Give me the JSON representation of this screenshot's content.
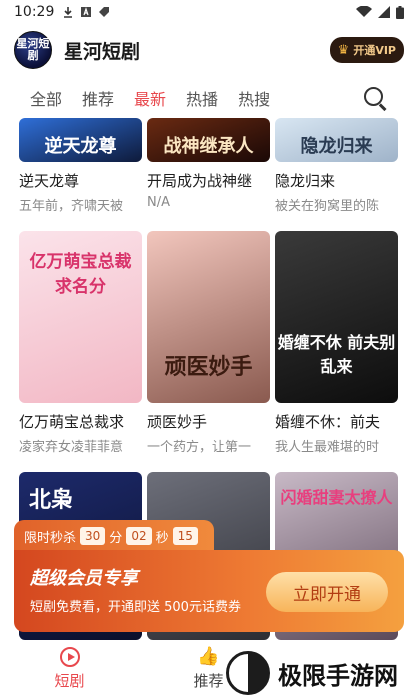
{
  "status_bar": {
    "time": "10:29"
  },
  "header": {
    "logo_text": "星河短剧",
    "title": "星河短剧",
    "vip_label": "开通VIP"
  },
  "tabs": [
    {
      "label": "全部"
    },
    {
      "label": "推荐"
    },
    {
      "label": "最新",
      "active": true
    },
    {
      "label": "热播"
    },
    {
      "label": "热搜"
    }
  ],
  "dramas": [
    {
      "poster_text": "逆天龙尊",
      "title": "逆天龙尊",
      "subtitle": "五年前，齐啸天被",
      "colors": [
        "#2f6fd8",
        "#0e1a3a"
      ]
    },
    {
      "poster_text": "战神继承人",
      "title": "开局成为战神继",
      "subtitle": "N/A",
      "colors": [
        "#6a2a12",
        "#1a0806"
      ]
    },
    {
      "poster_text": "隐龙归来",
      "title": "隐龙归来",
      "subtitle": "被关在狗窝里的陈",
      "colors": [
        "#d8e6f2",
        "#9fb3c9"
      ]
    },
    {
      "poster_text": "亿万萌宝总裁求名分",
      "title": "亿万萌宝总裁求",
      "subtitle": "凌家弃女凌菲菲意",
      "colors": [
        "#fbe3ea",
        "#f2b7c4"
      ]
    },
    {
      "poster_text": "顽医妙手",
      "title": "顽医妙手",
      "subtitle": "一个药方，让第一",
      "colors": [
        "#f2c6bd",
        "#8a5a4f"
      ]
    },
    {
      "poster_text": "婚缠不休 前夫别乱来",
      "title": "婚缠不休：前夫",
      "subtitle": "我人生最难堪的时",
      "colors": [
        "#3a3a3a",
        "#0d0d0d"
      ]
    },
    {
      "poster_text": "北枭",
      "title": "",
      "subtitle": "",
      "colors": [
        "#1d2a6b",
        "#0a0f2b"
      ]
    },
    {
      "poster_text": "",
      "title": "",
      "subtitle": "",
      "colors": [
        "#6d6f7a",
        "#2c2d33"
      ]
    },
    {
      "poster_text": "闪婚甜妻太撩人",
      "title": "",
      "subtitle": "",
      "colors": [
        "#c8b9c6",
        "#5b4a5a"
      ]
    }
  ],
  "promo": {
    "timer_label": "限时秒杀",
    "hours": "30",
    "hours_unit": "分",
    "minutes": "02",
    "minutes_unit": "秒",
    "seconds": "15",
    "headline": "超级会员专享",
    "description": "短剧免费看，开通即送 500元话费券",
    "cta": "立即开通"
  },
  "bottom_nav": [
    {
      "label": "短剧",
      "icon": "play-icon",
      "active": true
    },
    {
      "label": "推荐",
      "icon": "thumb-up-icon"
    },
    {
      "label": "",
      "icon": ""
    }
  ],
  "watermark": {
    "text": "极限手游网"
  },
  "colors": {
    "accent": "#e8484d",
    "promo": "#e0622a",
    "vip_bg": "#2b1a10"
  }
}
